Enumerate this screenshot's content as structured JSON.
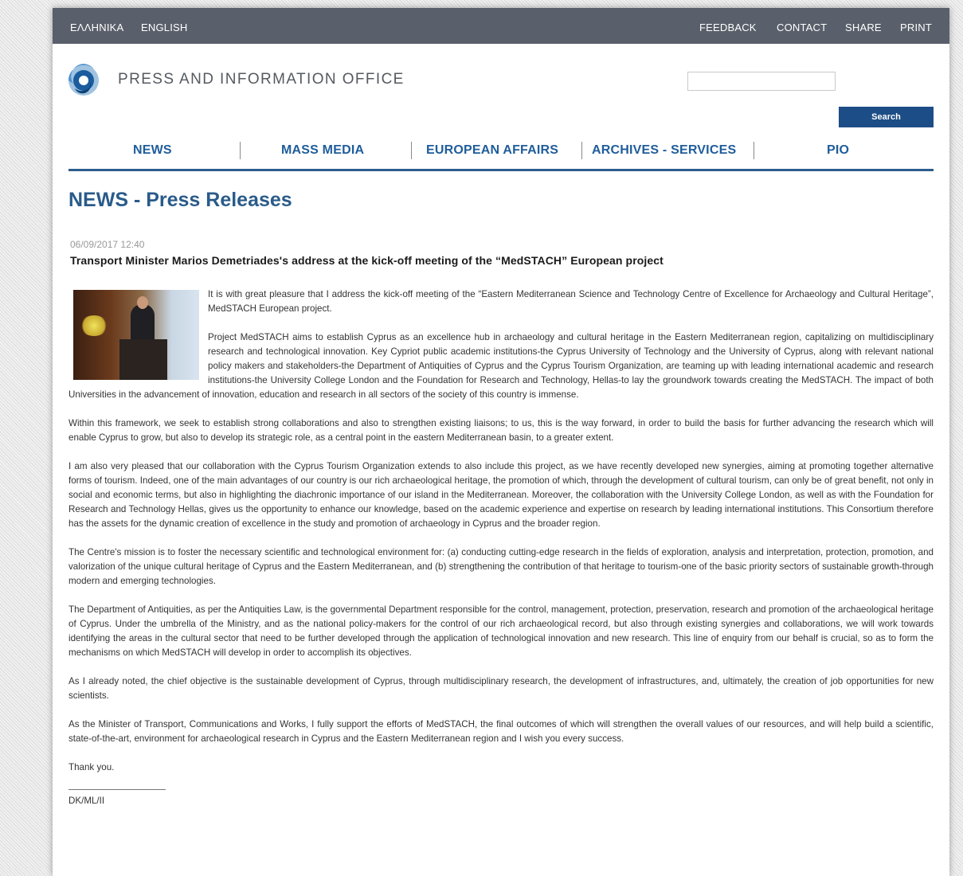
{
  "topbar": {
    "lang_greek": "ΕΛΛΗΝΙΚΑ",
    "lang_english": "ENGLISH",
    "feedback": "FEEDBACK",
    "contact": "CONTACT",
    "share": "SHARE",
    "print": "PRINT"
  },
  "header": {
    "site_name": "PRESS AND INFORMATION OFFICE",
    "search_value": "",
    "search_button": "Search"
  },
  "nav": {
    "items": [
      "NEWS",
      "MASS MEDIA",
      "EUROPEAN AFFAIRS",
      "ARCHIVES - SERVICES",
      "PIO"
    ]
  },
  "main": {
    "heading": "NEWS - Press Releases",
    "date": "06/09/2017 12:40",
    "title": "Transport Minister Marios Demetriades's address at the kick-off meeting of the “MedSTACH” European project",
    "paragraphs": [
      "It is with great pleasure that I address the kick-off meeting of the “Eastern Mediterranean Science and Technology Centre of Excellence for Archaeology and Cultural Heritage”, MedSTACH European project.",
      "Project MedSTACH aims to establish Cyprus as an excellence hub in archaeology and cultural heritage in the Eastern Mediterranean region, capitalizing on multidisciplinary research and technological innovation. Key Cypriot public academic institutions-the Cyprus University of Technology and the University of Cyprus, along with relevant national policy makers and stakeholders-the Department of Antiquities of Cyprus and the Cyprus Tourism Organization, are teaming up with leading international academic and research institutions-the University College London and the Foundation for Research and Technology, Hellas-to lay the groundwork towards creating the MedSTACH. The impact of both Universities in the advancement of innovation, education and research in all sectors of the society of this country is immense.",
      "Within this framework, we seek to establish strong collaborations and also to strengthen existing liaisons; to us, this is the way forward, in order to build the basis for further advancing the research which will enable Cyprus to grow, but also to develop its strategic role, as a central point in the eastern Mediterranean basin, to a greater extent.",
      "I am also very pleased that our collaboration with the Cyprus Tourism Organization extends to also include this project, as we have recently developed new synergies, aiming at promoting together alternative forms of tourism. Indeed, one of the main advantages of our country is our rich archaeological heritage, the promotion of which, through the development of cultural tourism, can only be of great benefit, not only in social and economic terms, but also in highlighting the diachronic importance of our island in the Mediterranean. Moreover, the collaboration with the University College London, as well as with the Foundation for Research and Technology Hellas, gives us the opportunity to enhance our knowledge, based on the academic experience and expertise on research by leading international institutions. This Consortium therefore has the assets for the dynamic creation of excellence in the study and promotion of archaeology in Cyprus and the broader region.",
      "The Centre's mission is to foster the necessary scientific and technological environment for: (a) conducting cutting-edge research in the fields of exploration, analysis and interpretation, protection, promotion, and valorization of the unique cultural heritage of Cyprus and the Eastern Mediterranean, and (b) strengthening the contribution of that heritage to tourism-one of the basic priority sectors of sustainable growth-through modern and emerging technologies.",
      "The Department of Antiquities, as per the Antiquities Law, is the governmental Department responsible for the control, management, protection, preservation, research and promotion of the archaeological heritage of Cyprus. Under the umbrella of the Ministry, and as the national policy-makers for the control of our rich archaeological record, but also through existing synergies and collaborations, we will work towards identifying the areas in the cultural sector that need to be further developed through the application of technological innovation and new research. This line of enquiry from our behalf is crucial, so as to form the mechanisms on which MedSTACH will develop in order to accomplish its objectives.",
      "As I already noted, the chief objective is the sustainable development of Cyprus, through multidisciplinary research, the development of infrastructures, and, ultimately, the creation of job opportunities for new scientists.",
      "As the Minister of Transport, Communications and Works, I fully support the efforts of MedSTACH, the final outcomes of which will strengthen the overall values of our resources, and will help build a scientific, state-of-the-art, environment for archaeological research in Cyprus and the Eastern Mediterranean region and I wish you every success.",
      "Thank you."
    ],
    "signature": "DK/ML/II"
  },
  "colors": {
    "topbar_bg": "#59606b",
    "nav_text": "#1f5d9b",
    "heading": "#2a5b8a",
    "search_button": "#1d4d86"
  }
}
